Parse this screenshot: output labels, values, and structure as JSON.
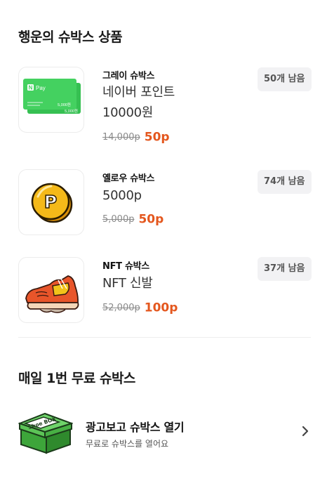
{
  "lucky_section": {
    "title": "행운의 슈박스 상품",
    "items": [
      {
        "box_name": "그레이 슈박스",
        "product_line1": "네이버 포인트",
        "product_line2": "10000원",
        "original_price": "14,000p",
        "sale_price": "50p",
        "remaining": "50개 남음",
        "icon": "naver-pay-card-icon",
        "card_label": "Pay",
        "card_amount": "5,000원"
      },
      {
        "box_name": "옐로우 슈박스",
        "product_line1": "5000p",
        "original_price": "5,000p",
        "sale_price": "50p",
        "remaining": "74개 남음",
        "icon": "gold-coin-p-icon",
        "coin_letter": "P"
      },
      {
        "box_name": "NFT 슈박스",
        "product_line1": "NFT 신발",
        "original_price": "52,000p",
        "sale_price": "100p",
        "remaining": "37개 남음",
        "icon": "sneaker-icon"
      }
    ]
  },
  "daily_section": {
    "title": "매일 1번 무료 슈박스",
    "ad_item": {
      "title": "광고보고 슈박스 열기",
      "subtitle": "무료로 슈박스를 열어요",
      "icon": "shoebox-icon",
      "box_text": "Shoe BOX",
      "chevron_icon": "chevron-right-icon"
    }
  },
  "colors": {
    "sale": "#e4571e",
    "naver_green": "#3fcf5a",
    "coin": "#f4b919",
    "badge_bg": "#f2f2f4"
  }
}
